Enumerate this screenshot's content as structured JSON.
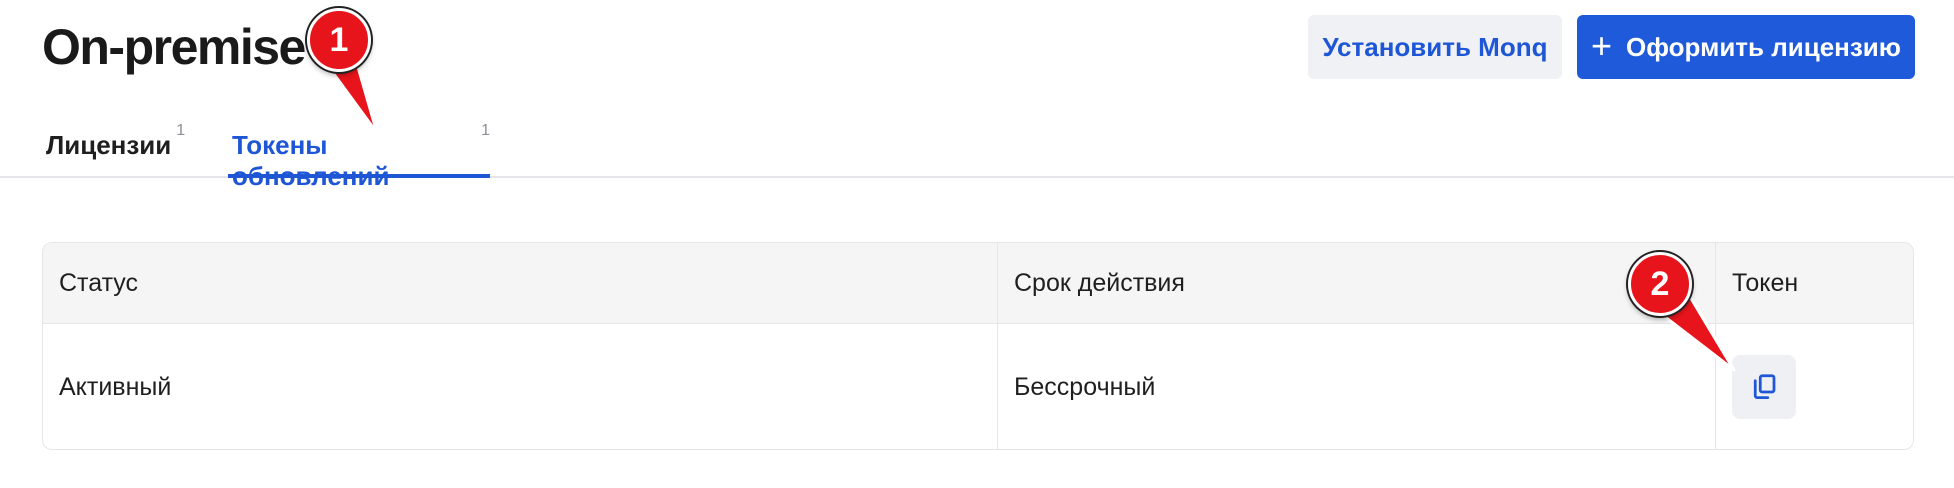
{
  "header": {
    "title": "On-premise",
    "install_button": "Установить Monq",
    "license_button_icon": "plus-icon",
    "license_button": "Оформить лицензию"
  },
  "tabs": [
    {
      "label": "Лицензии",
      "count": "1",
      "active": false
    },
    {
      "label": "Токены обновлений",
      "count": "1",
      "active": true
    }
  ],
  "table": {
    "columns": [
      "Статус",
      "Срок действия",
      "Токен"
    ],
    "rows": [
      {
        "status": "Активный",
        "validity": "Бессрочный",
        "token_action_icon": "copy-icon"
      }
    ]
  },
  "annotations": [
    {
      "label": "1"
    },
    {
      "label": "2"
    }
  ],
  "colors": {
    "accent": "#1e56d6",
    "primary_button": "#1e5ad9",
    "marker": "#e8141b"
  }
}
